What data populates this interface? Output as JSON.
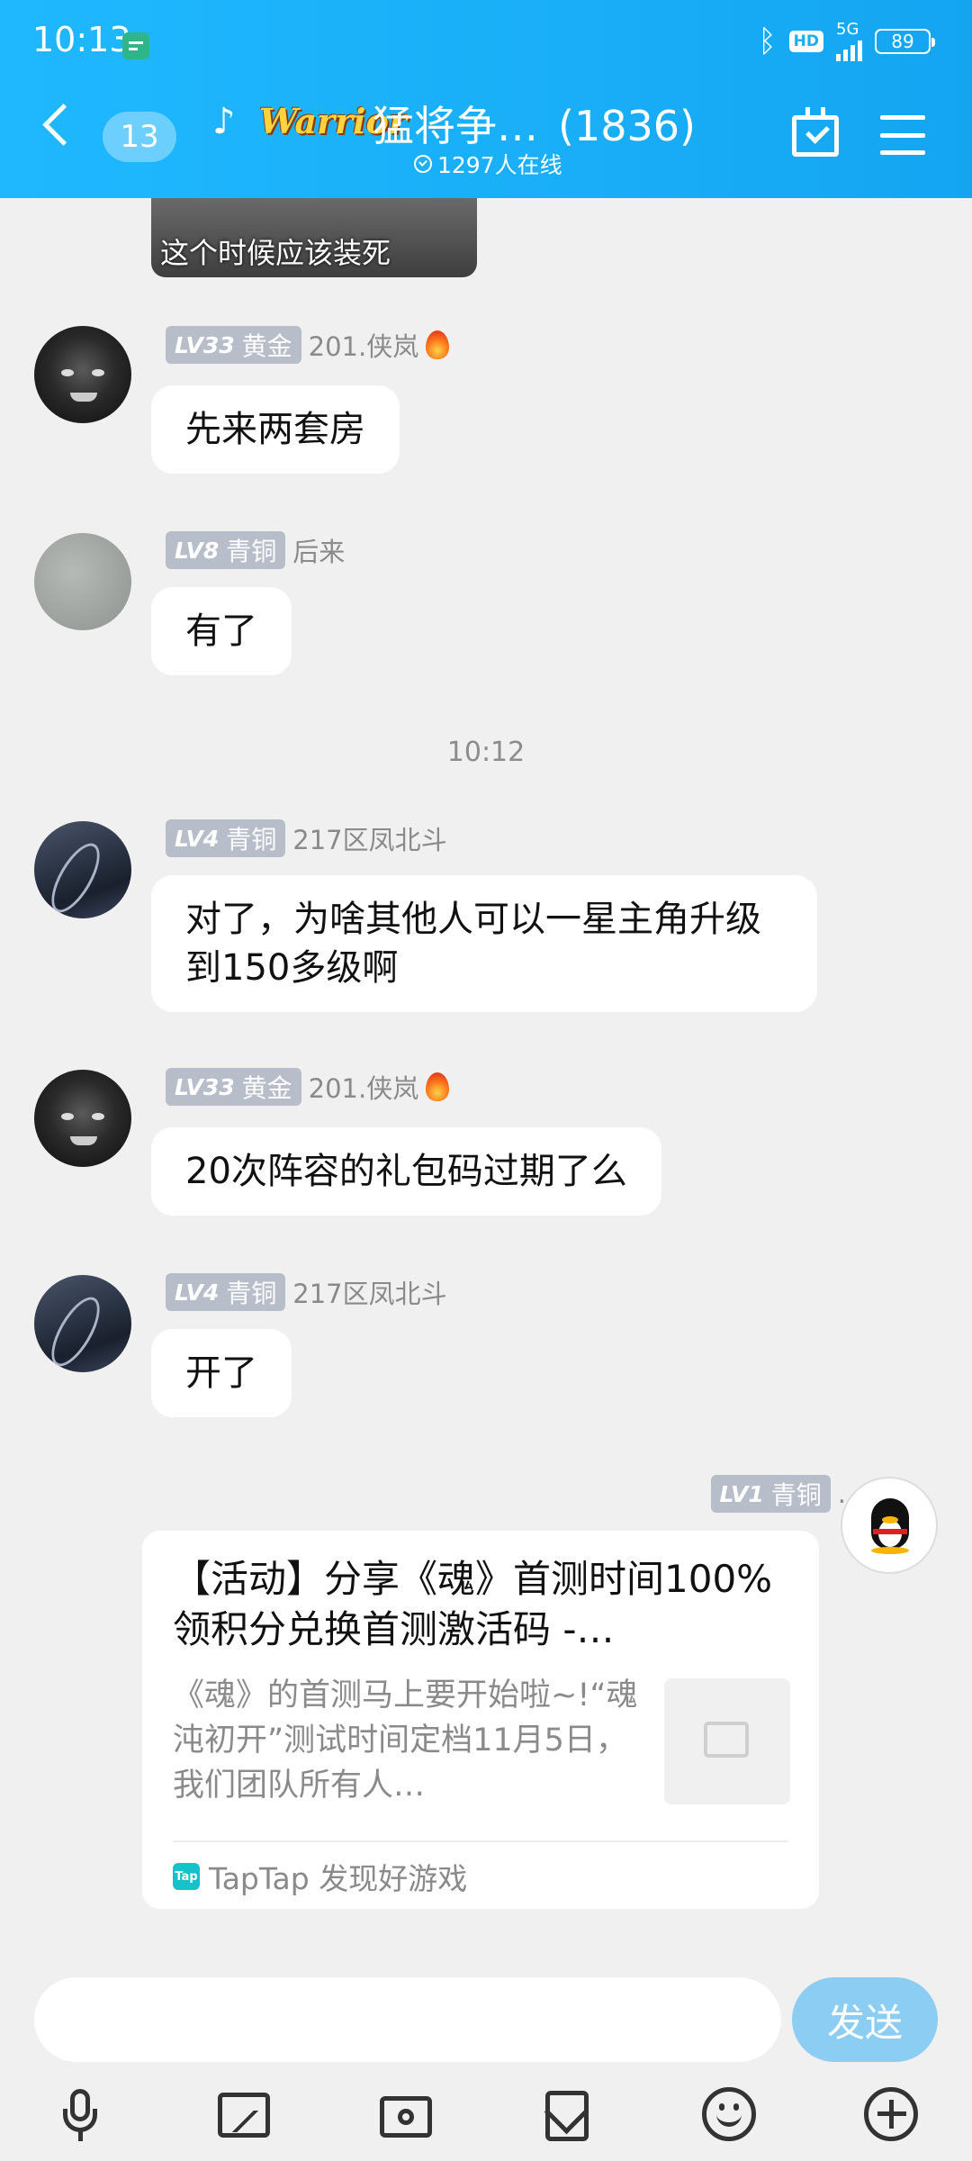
{
  "status_bar": {
    "time": "10:13",
    "hd_label": "HD",
    "network_label": "5G",
    "battery": "89"
  },
  "header": {
    "unread_count": "13",
    "group_logo_text": "Warrior",
    "group_name": "猛将争…",
    "member_count": "(1836)",
    "online_text": "1297人在线"
  },
  "chat": {
    "image_caption": "这个时候应该装死",
    "timestamp": "10:12",
    "messages": [
      {
        "level": "LV33",
        "rank": "黄金",
        "sender": "201.侠岚",
        "text": "先来两套房"
      },
      {
        "level": "LV8",
        "rank": "青铜",
        "sender": "后来",
        "text": "有了"
      },
      {
        "level": "LV4",
        "rank": "青铜",
        "sender": "217区凤北斗",
        "text": "对了，为啥其他人可以一星主角升级到150多级啊"
      },
      {
        "level": "LV33",
        "rank": "黄金",
        "sender": "201.侠岚",
        "text": "20次阵容的礼包码过期了么"
      },
      {
        "level": "LV4",
        "rank": "青铜",
        "sender": "217区凤北斗",
        "text": "开了"
      }
    ],
    "self_message": {
      "level": "LV1",
      "rank": "青铜",
      "sender": ".",
      "card": {
        "title": "【活动】分享《魂》首测时间100%领积分兑换首测激活码 -…",
        "description": "《魂》的首测马上要开始啦~!“魂沌初开”测试时间定档11月5日，我们团队所有人…",
        "source_badge": "Tap",
        "source": "TapTap 发现好游戏"
      }
    }
  },
  "input_bar": {
    "placeholder": "",
    "send_label": "发送"
  },
  "colors": {
    "header_blue": "#18aef6",
    "send_button": "#8ccdf3",
    "level_badge": "#b7bec9"
  }
}
